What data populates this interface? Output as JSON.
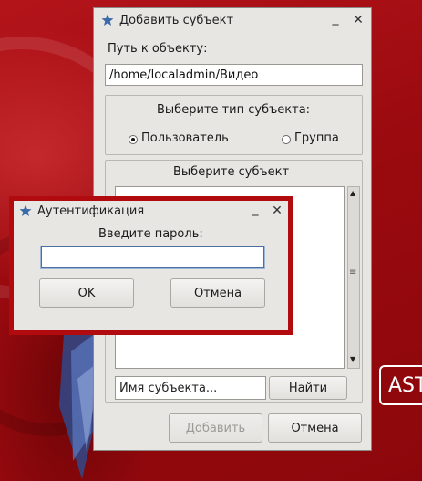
{
  "colors": {
    "desktop": "#a00a0e",
    "accent_border": "#b10b10",
    "window_bg": "#e8e6e2"
  },
  "desktop": {
    "logo_text": "AST"
  },
  "subject_window": {
    "title": "Добавить субъект",
    "minimize_glyph": "_",
    "close_glyph": "✕",
    "path_label": "Путь к объекту:",
    "path_value": "/home/localadmin/Видео",
    "type_group_title": "Выберите тип субъекта:",
    "radio_user_label": "Пользователь",
    "radio_group_label": "Группа",
    "radio_selected": "user",
    "subject_group_title": "Выберите субъект",
    "search_placeholder": "Имя субъекта...",
    "find_button": "Найти",
    "add_button": "Добавить",
    "cancel_button": "Отмена",
    "scroll_grip": "≡"
  },
  "auth_dialog": {
    "title": "Аутентификация",
    "minimize_glyph": "_",
    "close_glyph": "✕",
    "prompt": "Введите пароль:",
    "password_value": "",
    "ok_button": "OK",
    "cancel_button": "Отмена"
  }
}
